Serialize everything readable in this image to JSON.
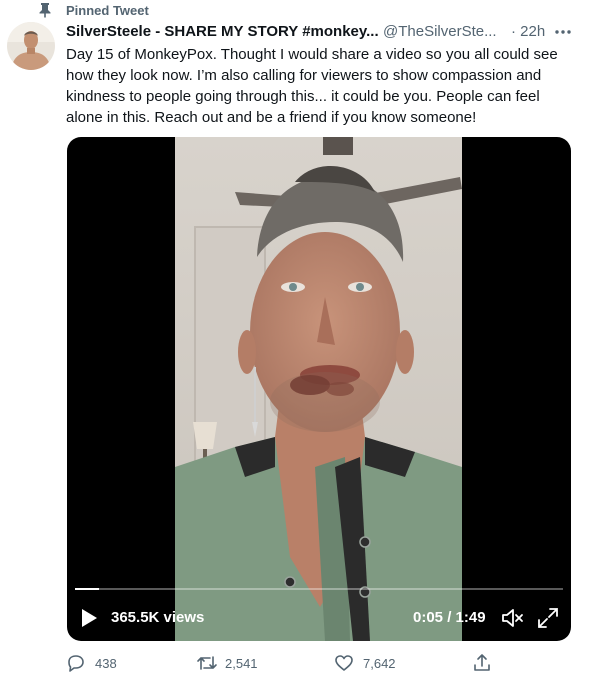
{
  "pinned": {
    "label": "Pinned Tweet",
    "icon": "pin-icon"
  },
  "tweet": {
    "author_name": "SilverSteele - SHARE MY STORY #monkey...",
    "author_handle": "@TheSilverSte...",
    "timestamp": "· 22h",
    "text_lines": [
      "Day 15 of MonkeyPox. Thought I would share a video so you all could see",
      "how they look now. I’m also calling for viewers to show compassion and",
      "kindness to people going through this... it could be you. People can feel",
      "alone in this. Reach out and be a friend if you know someone!"
    ]
  },
  "video": {
    "views": "365.5K views",
    "time": "0:05 / 1:49",
    "progress": 0.05
  },
  "actions": {
    "replies": "438",
    "retweets": "2,541",
    "likes": "7,642"
  },
  "colors": {
    "text": "#0f1419",
    "secondary": "#536471",
    "video_bg": "#000000"
  }
}
